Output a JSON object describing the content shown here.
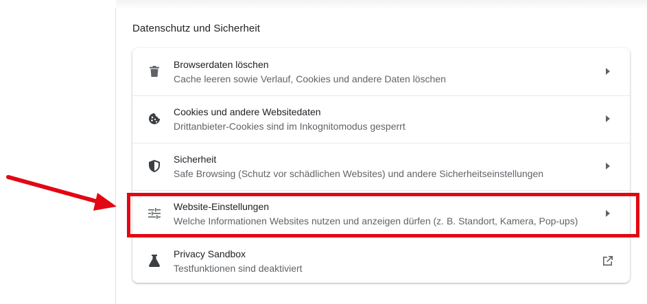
{
  "section": {
    "title": "Datenschutz und Sicherheit"
  },
  "items": [
    {
      "title": "Browserdaten löschen",
      "subtitle": "Cache leeren sowie Verlauf, Cookies und andere Daten löschen",
      "icon": "trash-icon",
      "action_icon": "chevron-right-icon"
    },
    {
      "title": "Cookies und andere Websitedaten",
      "subtitle": "Drittanbieter-Cookies sind im Inkognitomodus gesperrt",
      "icon": "cookie-icon",
      "action_icon": "chevron-right-icon"
    },
    {
      "title": "Sicherheit",
      "subtitle": "Safe Browsing (Schutz vor schädlichen Websites) und andere Sicherheitseinstellungen",
      "icon": "shield-icon",
      "action_icon": "chevron-right-icon"
    },
    {
      "title": "Website-Einstellungen",
      "subtitle": "Welche Informationen Websites nutzen und anzeigen dürfen (z. B. Standort, Kamera, Pop-ups)",
      "icon": "tune-sliders-icon",
      "action_icon": "chevron-right-icon"
    },
    {
      "title": "Privacy Sandbox",
      "subtitle": "Testfunktionen sind deaktiviert",
      "icon": "flask-icon",
      "action_icon": "open-in-new-icon"
    }
  ],
  "colors": {
    "annotation_red": "#e30613",
    "text_primary": "#202124",
    "text_secondary": "#5f6368",
    "icon": "#5f6368"
  }
}
